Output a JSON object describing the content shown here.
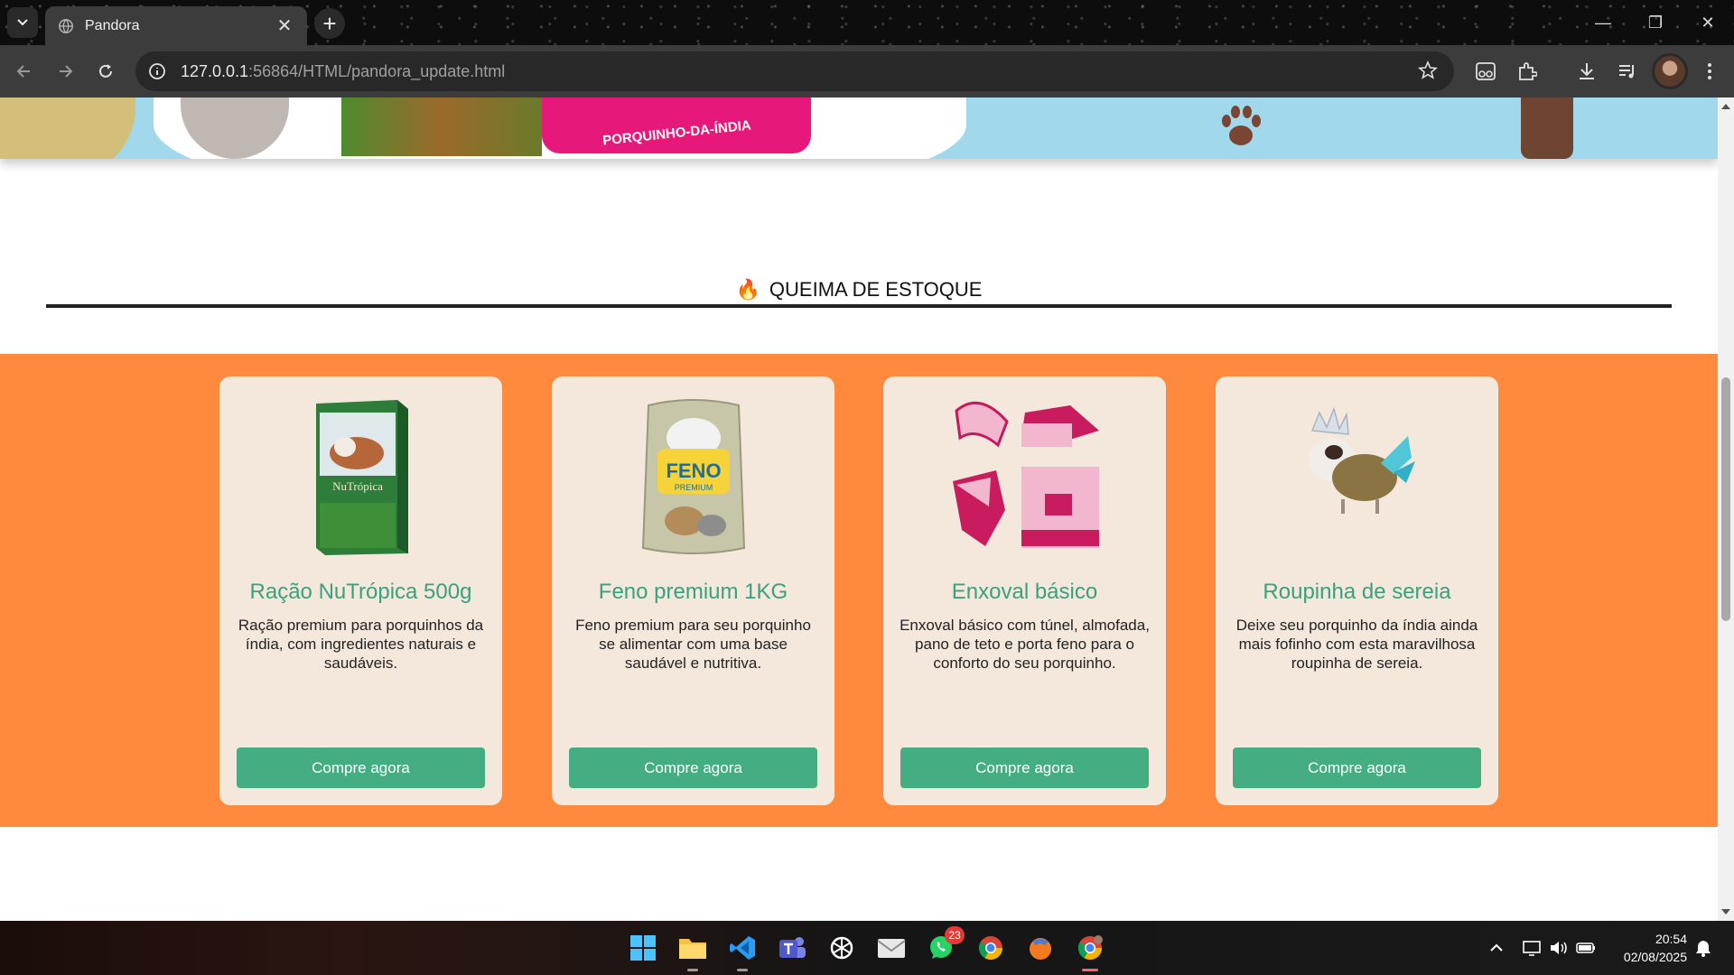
{
  "browser": {
    "tab_title": "Pandora",
    "url_host": "127.0.0.1",
    "url_rest": ":56864/HTML/pandora_update.html"
  },
  "banner": {
    "pack_text": "PORQUINHO-DA-ÍNDIA"
  },
  "section": {
    "icon": "🔥",
    "title": "QUEIMA DE ESTOQUE"
  },
  "products": [
    {
      "title": "Ração NuTrópica 500g",
      "description": "Ração premium para porquinhos da índia, com ingredientes naturais e saudáveis.",
      "button": "Compre agora",
      "image_brand": "NuTrópica"
    },
    {
      "title": "Feno premium 1KG",
      "description": "Feno premium para seu porquinho se alimentar com uma base saudável e nutritiva.",
      "button": "Compre agora",
      "image_brand": "FENO",
      "image_sub": "PREMIUM"
    },
    {
      "title": "Enxoval básico",
      "description": "Enxoval básico com túnel, almofada, pano de teto e porta feno para o conforto do seu porquinho.",
      "button": "Compre agora"
    },
    {
      "title": "Roupinha de sereia",
      "description": "Deixe seu porquinho da índia ainda mais fofinho com esta maravilhosa roupinha de sereia.",
      "button": "Compre agora"
    }
  ],
  "taskbar": {
    "whatsapp_badge": "23",
    "time": "20:54",
    "date": "02/08/2025"
  },
  "colors": {
    "promo_background": "#ff8a3d",
    "card_background": "#f4e8dc",
    "title_green": "#3aa17e",
    "button_green": "#45ad82"
  }
}
